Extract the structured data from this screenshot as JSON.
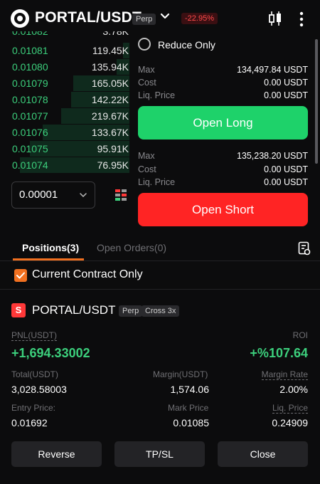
{
  "header": {
    "pair": "PORTAL/USDT",
    "type_tag": "Perp",
    "change": "-22.95%"
  },
  "orderbook": {
    "cut_row": {
      "price": "0.01082",
      "size": "3.78K"
    },
    "rows": [
      {
        "price": "0.01081",
        "size": "119.45K",
        "depth": 0.05
      },
      {
        "price": "0.01080",
        "size": "135.94K",
        "depth": 0.1
      },
      {
        "price": "0.01079",
        "size": "165.05K",
        "depth": 0.45
      },
      {
        "price": "0.01078",
        "size": "142.22K",
        "depth": 0.47
      },
      {
        "price": "0.01077",
        "size": "219.67K",
        "depth": 0.55
      },
      {
        "price": "0.01076",
        "size": "133.67K",
        "depth": 0.7
      },
      {
        "price": "0.01075",
        "size": "95.91K",
        "depth": 0.8
      },
      {
        "price": "0.01074",
        "size": "76.95K",
        "depth": 0.88
      }
    ],
    "precision": "0.00001"
  },
  "trade": {
    "reduce_only": "Reduce Only",
    "long_info": [
      {
        "label": "Max",
        "value": "134,497.84 USDT"
      },
      {
        "label": "Cost",
        "value": "0.00 USDT"
      },
      {
        "label": "Liq. Price",
        "value": "0.00 USDT"
      }
    ],
    "open_long": "Open Long",
    "short_info": [
      {
        "label": "Max",
        "value": "135,238.20 USDT"
      },
      {
        "label": "Cost",
        "value": "0.00 USDT"
      },
      {
        "label": "Liq. Price",
        "value": "0.00 USDT"
      }
    ],
    "open_short": "Open Short"
  },
  "tabs": {
    "positions": "Positions(3)",
    "open_orders": "Open Orders(0)"
  },
  "filter": {
    "current_contract_only": "Current Contract Only"
  },
  "position": {
    "badge_letter": "S",
    "pair": "PORTAL/USDT",
    "type_tag": "Perp",
    "margin_tag": "Cross 3x",
    "pnl_label": "PNL(USDT)",
    "pnl_value": "+1,694.33002",
    "roi_label": "ROI",
    "roi_value": "+%107.64",
    "total_label": "Total(USDT)",
    "total_value": "3,028.58003",
    "margin_label": "Margin(USDT)",
    "margin_value": "1,574.06",
    "margin_rate_label": "Margin Rate",
    "margin_rate_value": "2.00%",
    "entry_label": "Entry Price:",
    "entry_value": "0.01692",
    "mark_label": "Mark Price",
    "mark_value": "0.01085",
    "liq_label": "Liq. Price",
    "liq_value": "0.24909"
  },
  "actions": {
    "reverse": "Reverse",
    "tpsl": "TP/SL",
    "close": "Close"
  },
  "colors": {
    "buy": "#3ccf7c",
    "sell": "#ff2424",
    "accent": "#f07020",
    "background": "#0c0c0d"
  }
}
